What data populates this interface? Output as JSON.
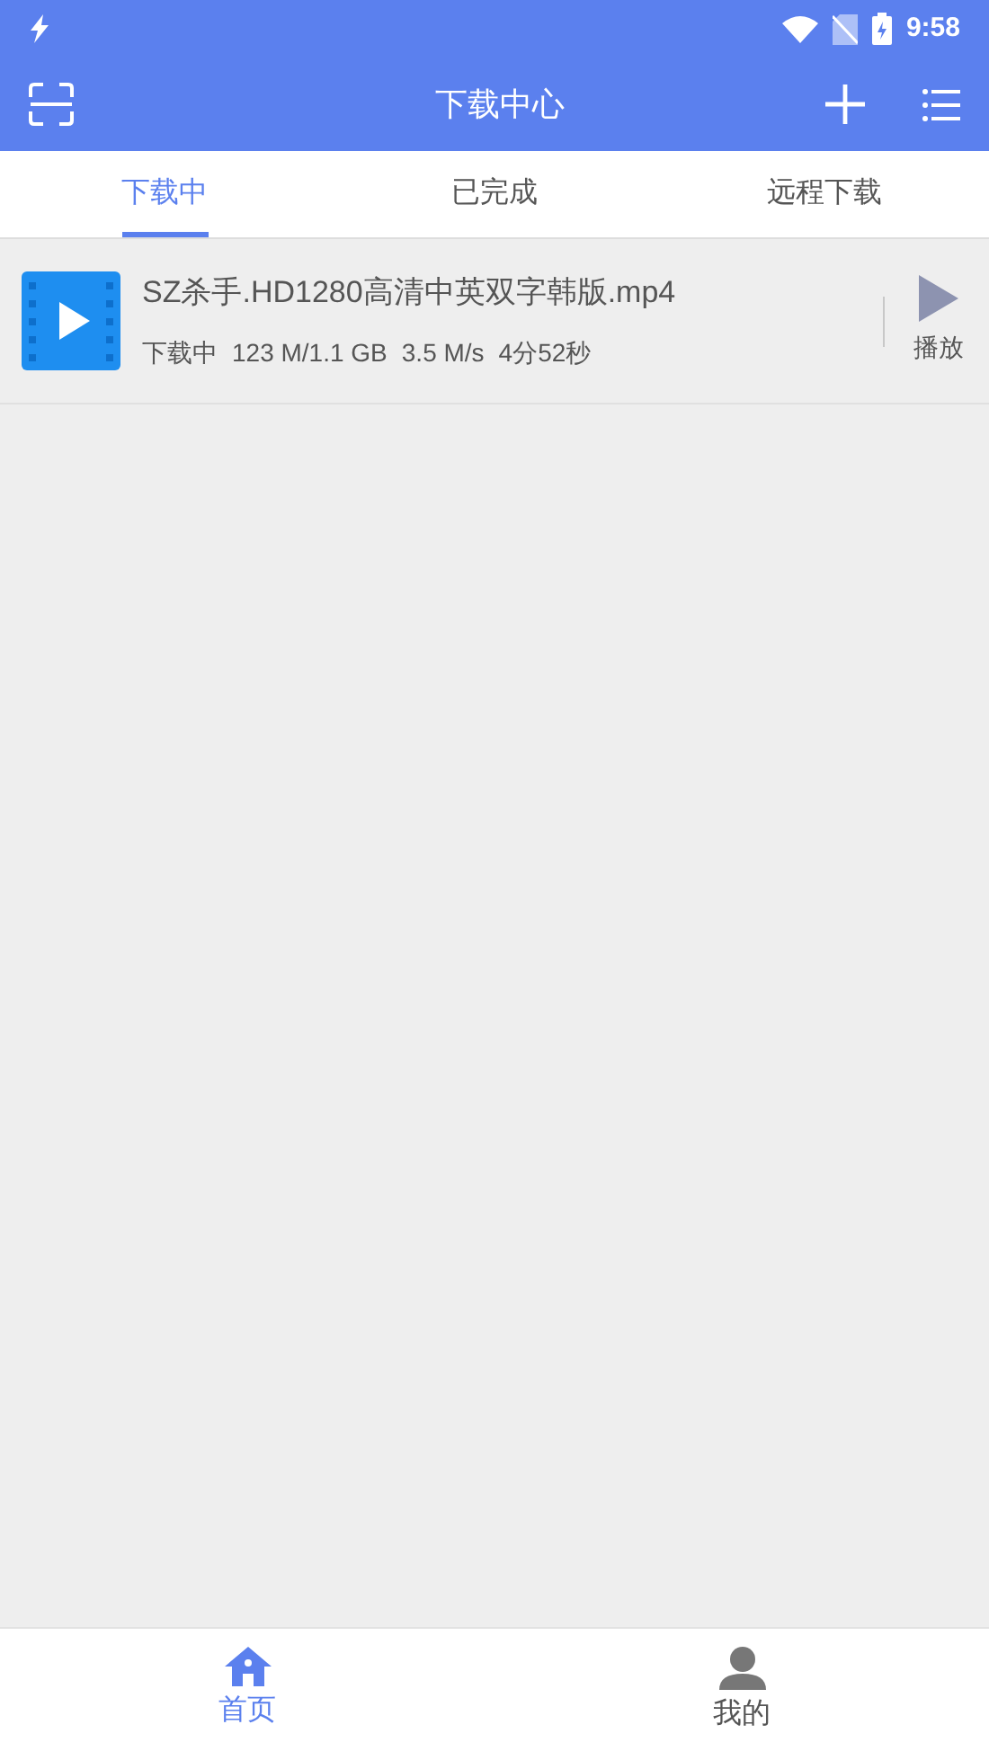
{
  "status_bar": {
    "time": "9:58"
  },
  "toolbar": {
    "title": "下载中心"
  },
  "tabs": [
    {
      "label": "下载中",
      "selected": true
    },
    {
      "label": "已完成",
      "selected": false
    },
    {
      "label": "远程下载",
      "selected": false
    }
  ],
  "downloads": [
    {
      "name": "SZ杀手.HD1280高清中英双字韩版.mp4",
      "status": "下载中",
      "size": "123 M/1.1 GB",
      "speed": "3.5 M/s",
      "remaining": "4分52秒",
      "action": "播放"
    }
  ],
  "bottom_nav": [
    {
      "label": "首页",
      "kind": "home",
      "selected": true
    },
    {
      "label": "我的",
      "kind": "person",
      "selected": false
    }
  ]
}
